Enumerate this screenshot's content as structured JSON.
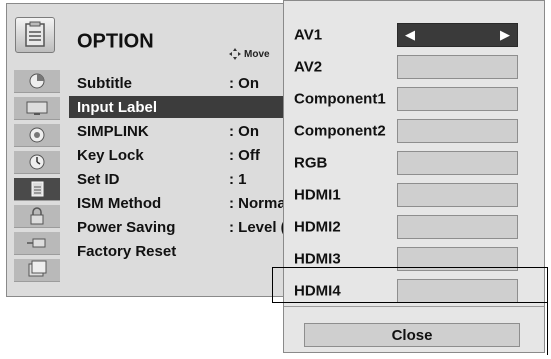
{
  "option_panel": {
    "title": "OPTION",
    "move_hint": "Move",
    "menu": [
      {
        "label": "Subtitle",
        "value": ": On",
        "selected": false
      },
      {
        "label": "Input Label",
        "value": "",
        "selected": true
      },
      {
        "label": "SIMPLINK",
        "value": ": On",
        "selected": false
      },
      {
        "label": "Key Lock",
        "value": ": Off",
        "selected": false
      },
      {
        "label": "Set ID",
        "value": ": 1",
        "selected": false
      },
      {
        "label": "ISM Method",
        "value": ": Norma",
        "selected": false
      },
      {
        "label": "Power Saving",
        "value": ": Level (",
        "selected": false
      },
      {
        "label": "Factory Reset",
        "value": "",
        "selected": false
      }
    ],
    "rail_icons": [
      "picture-icon",
      "tv-icon",
      "audio-icon",
      "clock-icon",
      "option-icon",
      "lock-icon",
      "input-icon",
      "usb-icon"
    ]
  },
  "input_label_popup": {
    "sources": [
      {
        "name": "AV1",
        "selector": true
      },
      {
        "name": "AV2",
        "selector": false
      },
      {
        "name": "Component1",
        "selector": false
      },
      {
        "name": "Component2",
        "selector": false
      },
      {
        "name": "RGB",
        "selector": false
      },
      {
        "name": "HDMI1",
        "selector": false
      },
      {
        "name": "HDMI2",
        "selector": false
      },
      {
        "name": "HDMI3",
        "selector": false
      },
      {
        "name": "HDMI4",
        "selector": false
      }
    ],
    "close_label": "Close"
  }
}
